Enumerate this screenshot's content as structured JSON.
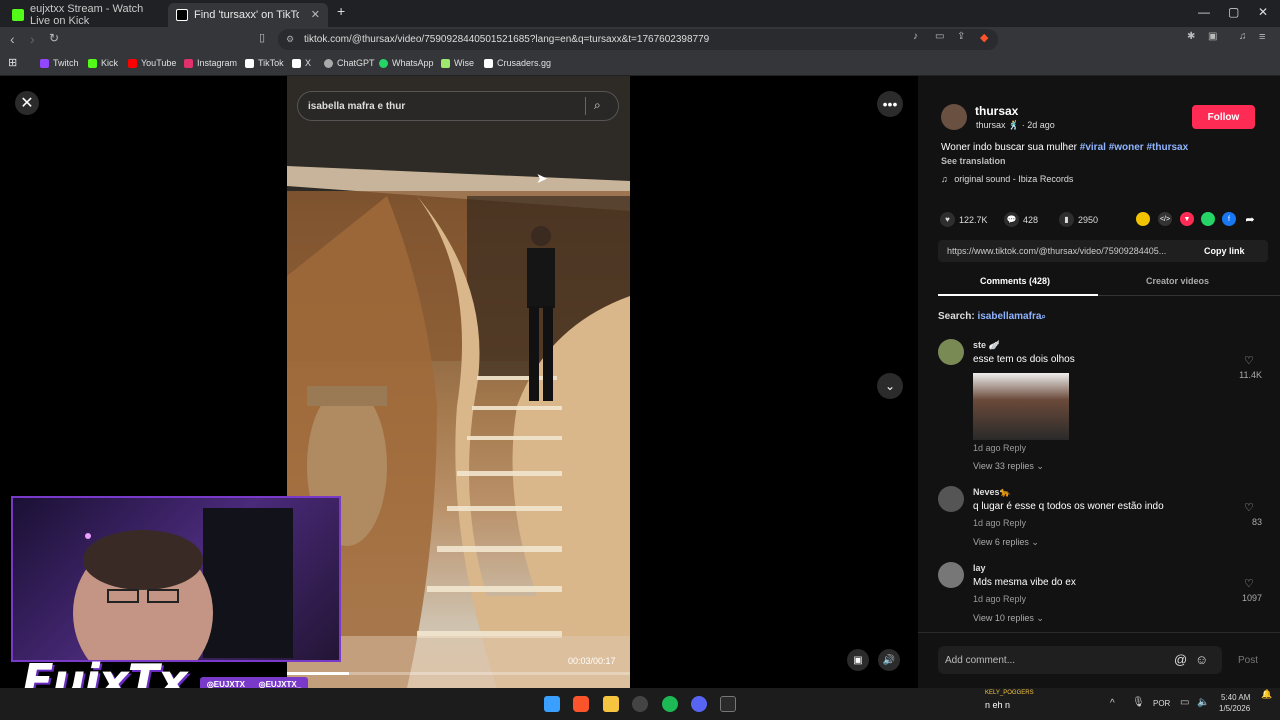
{
  "browser": {
    "tabs": [
      {
        "title": "eujxtxx Stream - Watch Live on Kick",
        "color": "#53fc18"
      },
      {
        "title": "Find 'tursaxx' on TikTok | TikT",
        "color": "#ffffff"
      }
    ],
    "url": "tiktok.com/@thursax/video/7590928440501521685?lang=en&q=tursaxx&t=1767602398779",
    "bookmarks": [
      {
        "label": "Twitch",
        "color": "#9146ff"
      },
      {
        "label": "Kick",
        "color": "#53fc18"
      },
      {
        "label": "YouTube",
        "color": "#ff0000"
      },
      {
        "label": "Instagram",
        "color": "#e1306c"
      },
      {
        "label": "TikTok",
        "color": "#ffffff"
      },
      {
        "label": "X",
        "color": "#ffffff"
      },
      {
        "label": "ChatGPT",
        "color": "#aaaaaa"
      },
      {
        "label": "WhatsApp",
        "color": "#25d366"
      },
      {
        "label": "Wise",
        "color": "#9fe870"
      },
      {
        "label": "Crusaders.gg",
        "color": "#ffffff"
      }
    ]
  },
  "video": {
    "search_query": "isabella mafra e thur",
    "time": "00:03/00:17",
    "progress": 0.18
  },
  "overlay": {
    "streamer": "EujxTx",
    "socials": [
      "◎EUJXTX",
      "◎EUJXTX_"
    ]
  },
  "post": {
    "author": "thursax",
    "handle_line": "thursax 🕺 · 2d ago",
    "follow_label": "Follow",
    "caption": "Woner indo buscar sua mulher",
    "hashtags": "#viral #woner #thursax",
    "see_translation": "See translation",
    "music": "original sound - Ibiza Records",
    "likes": "122.7K",
    "comments": "428",
    "saves": "2950",
    "link": "https://www.tiktok.com/@thursax/video/75909284405...",
    "copy_link": "Copy link",
    "tab_comments": "Comments (428)",
    "tab_creator": "Creator videos",
    "search_label": "Search:",
    "search_term": "isabellamafra",
    "comment_placeholder": "Add comment...",
    "post_label": "Post"
  },
  "comments": [
    {
      "name": "ste 🪽",
      "text": "esse tem os dois olhos",
      "meta": "1d ago    Reply",
      "views": "View 33 replies ⌄",
      "likes": "11.4K"
    },
    {
      "name": "Neves🐆",
      "text": "q lugar é esse q todos os woner estão indo",
      "meta": "1d ago    Reply",
      "views": "View 6 replies ⌄",
      "likes": "83"
    },
    {
      "name": "lay",
      "text": "Mds mesma vibe do ex",
      "meta": "1d ago    Reply",
      "views": "View 10 replies ⌄",
      "likes": "1097"
    }
  ],
  "taskbar": {
    "notify_title": "KELY_POGGERS",
    "notify_text": "n eh n",
    "lang": "POR",
    "time": "5:40 AM",
    "date": "1/5/2026"
  }
}
